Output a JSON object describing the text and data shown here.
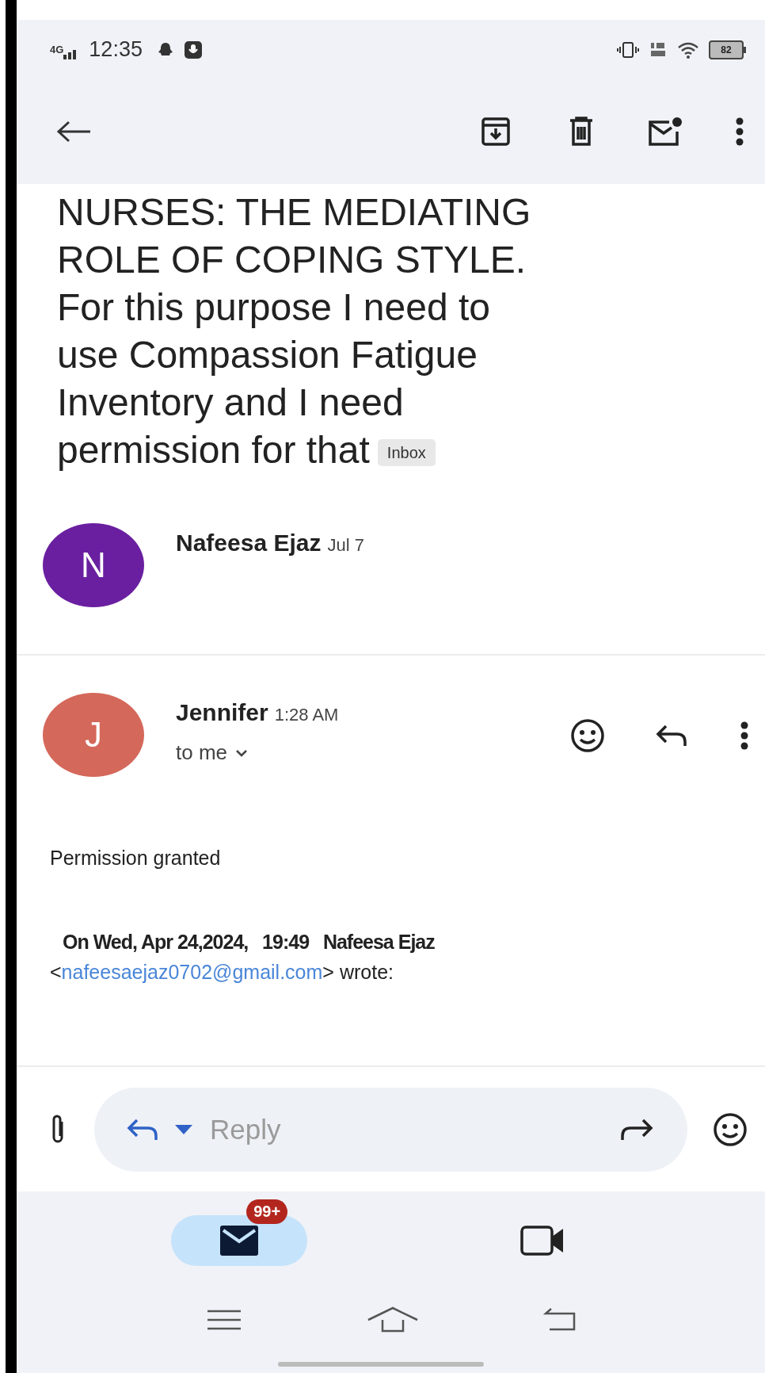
{
  "status_bar": {
    "network": "4G",
    "time": "12:35",
    "battery": "82"
  },
  "toolbar": {
    "actions": [
      {
        "kind": "archive"
      },
      {
        "kind": "delete"
      },
      {
        "kind": "unread"
      },
      {
        "kind": "more"
      }
    ]
  },
  "subject": {
    "lines": [
      "NURSES: THE MEDIATING",
      "ROLE OF COPING STYLE.",
      "For this purpose I need to",
      "use Compassion Fatigue",
      "Inventory and I need",
      "permission for that"
    ],
    "label": "Inbox"
  },
  "messages": [
    {
      "avatar": "N",
      "color": "#6a1fa0",
      "sender": "Nafeesa Ejaz",
      "time": "Jul 7",
      "expanded": false
    },
    {
      "avatar": "J",
      "color": "#d4685a",
      "sender": "Jennifer",
      "time": "1:28 AM",
      "expanded": true,
      "recipient": "to me",
      "body": "Permission granted",
      "quote_header": "On Wed, Apr 24,2024,   19:49   Nafeesa Ejaz",
      "quote_email": "nafeesaejaz0702@gmail.com",
      "quote_open": "<",
      "quote_close": "> wrote:"
    }
  ],
  "reply_bar": {
    "placeholder": "Reply"
  },
  "bottom_nav": {
    "items": [
      {
        "kind": "mail",
        "selected": true,
        "badge": "99+"
      },
      {
        "kind": "video",
        "selected": false
      }
    ]
  }
}
